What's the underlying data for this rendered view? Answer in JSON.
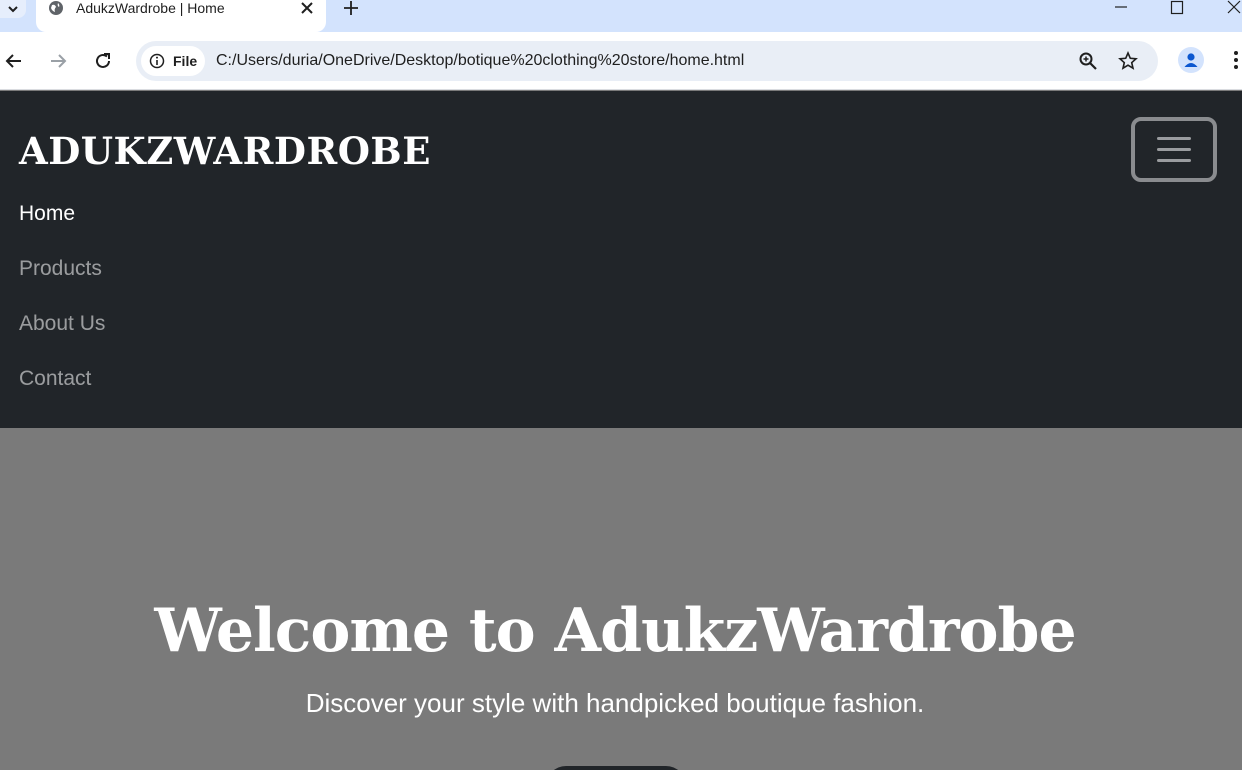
{
  "browser": {
    "tab_title": "AdukzWardrobe | Home",
    "address_chip": "File",
    "url": "C:/Users/duria/OneDrive/Desktop/botique%20clothing%20store/home.html"
  },
  "site": {
    "brand": "ADUKZWARDROBE",
    "nav_items": [
      {
        "label": "Home",
        "active": true
      },
      {
        "label": "Products",
        "active": false
      },
      {
        "label": "About Us",
        "active": false
      },
      {
        "label": "Contact",
        "active": false
      }
    ]
  },
  "hero": {
    "title": "Welcome to AdukzWardrobe",
    "subtitle": "Discover your style with handpicked boutique fashion."
  },
  "colors": {
    "navbar_bg": "#212529",
    "hero_bg": "#7a7a7a",
    "tabstrip_bg": "#d3e3fd",
    "omnibox_bg": "#e9eef6"
  },
  "icons": [
    "tab-search-icon",
    "globe-icon",
    "close-icon",
    "plus-icon",
    "minimize-icon",
    "maximize-icon",
    "window-close-icon",
    "back-icon",
    "forward-icon",
    "reload-icon",
    "info-icon",
    "zoom-icon",
    "star-icon",
    "profile-icon",
    "menu-kebab-icon",
    "hamburger-icon"
  ]
}
